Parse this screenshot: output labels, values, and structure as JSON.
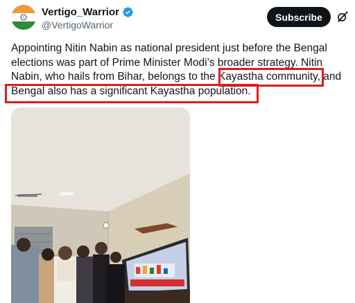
{
  "author": {
    "display_name": "Vertigo_Warrior",
    "handle": "@VertigoWarrior",
    "avatar_icon": "india-flag-avatar",
    "verified_icon": "verified-badge-icon",
    "verified_color": "#1d9bf0"
  },
  "actions": {
    "subscribe_label": "Subscribe",
    "grok_icon": "grok-icon"
  },
  "tweet": {
    "lines": [
      "Appointing Nitin Nabin as national president just before the Bengal",
      "elections was part of Prime Minister Modi’s broader strategy. Nitin",
      "Nabin, who hails from Bihar, belongs to the Kayastha community, and",
      "Bengal also has a significant Kayastha population."
    ],
    "highlight_color": "#e01b1b"
  },
  "media": {
    "type": "video-thumbnail"
  }
}
